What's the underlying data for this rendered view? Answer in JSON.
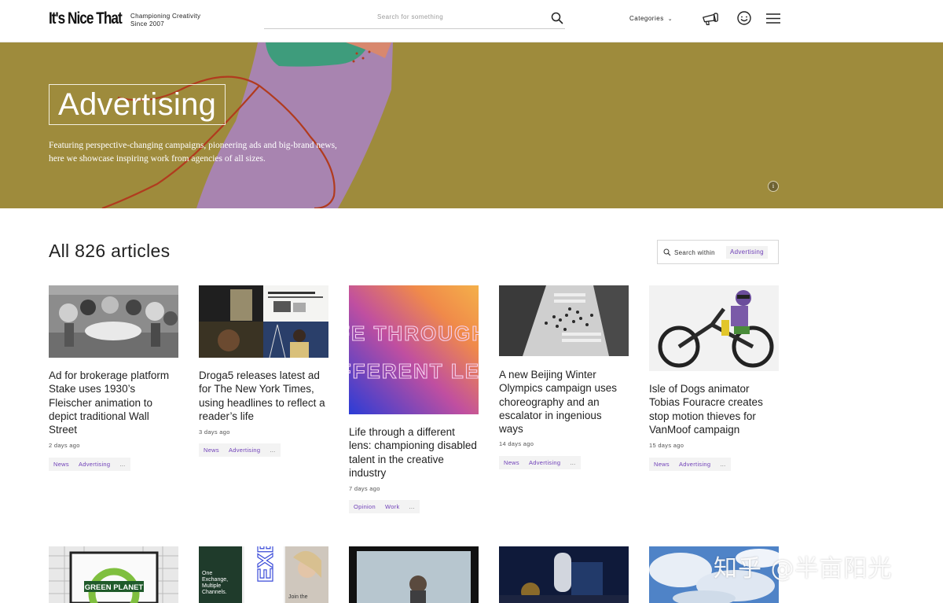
{
  "header": {
    "logo": "It's Nice That",
    "tagline_line1": "Championing Creativity",
    "tagline_line2": "Since 2007",
    "search_placeholder": "Search for something",
    "categories_label": "Categories"
  },
  "hero": {
    "title": "Advertising",
    "description": "Featuring perspective-changing campaigns, pioneering ads and big-brand news, here we showcase inspiring work from agencies of all sizes.",
    "info_label": "i",
    "bg_color": "#9e8b3c"
  },
  "listing": {
    "count_title": "All 826 articles",
    "search_within_label": "Search within",
    "search_within_tag": "Advertising"
  },
  "articles": [
    {
      "title": "Ad for brokerage platform Stake uses 1930’s Fleischer animation to depict traditional Wall Street",
      "date": "2 days ago",
      "tags": [
        "News",
        "Advertising",
        "..."
      ]
    },
    {
      "title": "Droga5 releases latest ad for The New York Times, using headlines to reflect a reader’s life",
      "date": "3 days ago",
      "tags": [
        "News",
        "Advertising",
        "..."
      ]
    },
    {
      "title": "Life through a different lens: championing disabled talent in the creative industry",
      "date": "7 days ago",
      "tags": [
        "Opinion",
        "Work",
        "..."
      ],
      "poster_text": "LIFE THROUGH A DIFFERENT LENS"
    },
    {
      "title": "A new Beijing Winter Olympics campaign uses choreography and an escalator in ingenious ways",
      "date": "14 days ago",
      "tags": [
        "News",
        "Advertising",
        "..."
      ]
    },
    {
      "title": "Isle of Dogs animator Tobias Fouracre creates stop motion thieves for VanMoof campaign",
      "date": "15 days ago",
      "tags": [
        "News",
        "Advertising",
        "..."
      ]
    }
  ],
  "bottom_row": {
    "sign_text": "GREEN PLANET",
    "card2_text1": "One Exchange, Multiple Channels.",
    "card2_text2": "Join the"
  },
  "watermark": "知乎 @半亩阳光",
  "colors": {
    "accent": "#6f3fb8",
    "hero_bg": "#9e8b3c"
  }
}
